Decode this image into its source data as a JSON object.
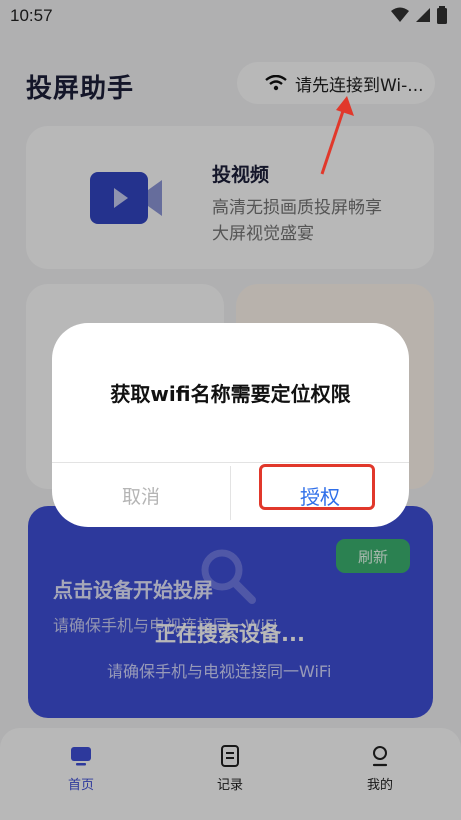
{
  "status": {
    "time": "10:57"
  },
  "header": {
    "title": "投屏助手",
    "wifi_text": "请先连接到Wi-..."
  },
  "video_card": {
    "title": "投视频",
    "sub1": "高清无损画质投屏畅享",
    "sub2": "大屏视觉盛宴"
  },
  "device_card": {
    "refresh": "刷新",
    "heading": "点击设备开始投屏",
    "sub": "请确保手机与电视连接同一WiFi",
    "searching": "正在搜索设备...",
    "hint": "请确保手机与电视连接同一WiFi"
  },
  "tabs": [
    {
      "label": "首页",
      "active": true
    },
    {
      "label": "记录",
      "active": false
    },
    {
      "label": "我的",
      "active": false
    }
  ],
  "dialog": {
    "message": "获取wifi名称需要定位权限",
    "cancel": "取消",
    "confirm": "授权"
  },
  "colors": {
    "accent": "#2f6fe9",
    "primary_card": "#3f4fd9",
    "highlight": "#e1382b"
  }
}
